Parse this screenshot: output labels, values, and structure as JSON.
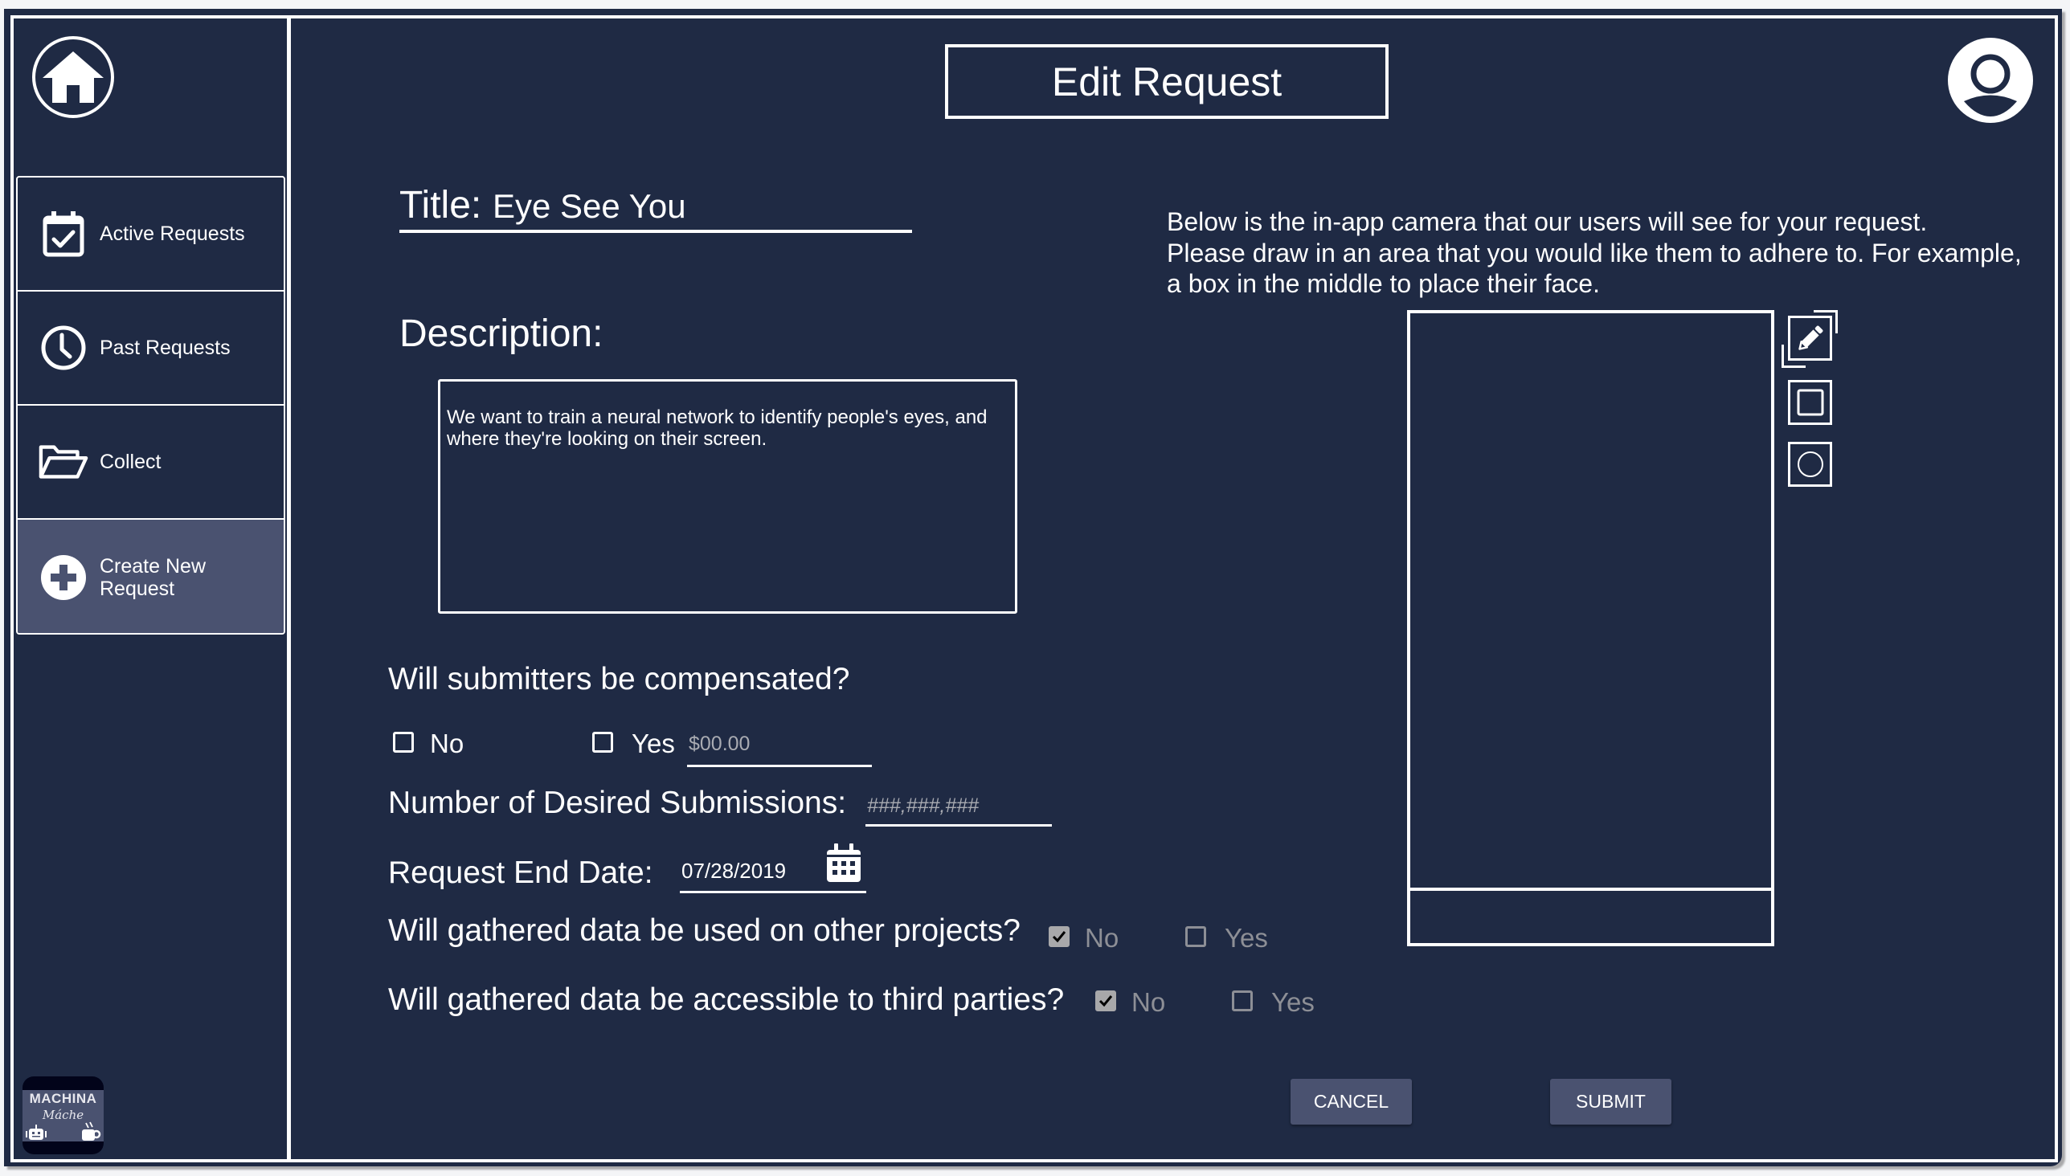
{
  "header": {
    "title": "Edit Request"
  },
  "sidebar": {
    "home_icon": "home-icon",
    "items": [
      {
        "label": "Active Requests",
        "icon": "calendar-check-icon",
        "active": false
      },
      {
        "label": "Past Requests",
        "icon": "clock-icon",
        "active": false
      },
      {
        "label": "Collect",
        "icon": "folder-open-icon",
        "active": false
      },
      {
        "label": "Create New Request",
        "icon": "plus-circle-icon",
        "active": true
      }
    ],
    "logo": {
      "line1": "MACHINA",
      "line2": "Máche"
    }
  },
  "user": {
    "avatar_icon": "user-circle-icon"
  },
  "form": {
    "title_label": "Title:",
    "title_value": "Eye See You",
    "description_label": "Description:",
    "description_value": "We want to train a neural network to identify people's eyes, and where they're looking on their screen.",
    "compensation": {
      "question": "Will submitters be compensated?",
      "no_label": "No",
      "no_checked": false,
      "yes_label": "Yes",
      "yes_checked": false,
      "amount_placeholder": "$00.00",
      "amount_value": ""
    },
    "submissions": {
      "label": "Number of Desired Submissions:",
      "placeholder": "###,###,###",
      "value": ""
    },
    "end_date": {
      "label": "Request End Date:",
      "value": "07/28/2019",
      "calendar_icon": "calendar-icon"
    },
    "other_projects": {
      "question": "Will gathered data be used on other projects?",
      "no_label": "No",
      "no_checked": true,
      "yes_label": "Yes",
      "yes_checked": false
    },
    "third_parties": {
      "question": "Will gathered data be accessible to third parties?",
      "no_label": "No",
      "no_checked": true,
      "yes_label": "Yes",
      "yes_checked": false
    }
  },
  "camera": {
    "instructions": "Below is the in-app camera that our users will see for your request. Please draw in an area that you would like them to adhere to. For example, a box in the middle to place their face.",
    "instruction_lines": [
      "Below is the in-app camera that our users will see for your request.",
      "Please draw in an area that you would like them to adhere to. For example,",
      "a box in the middle to place their face."
    ],
    "tools": [
      {
        "name": "pencil",
        "icon": "pencil-icon",
        "selected": true
      },
      {
        "name": "rectangle",
        "icon": "square-icon",
        "selected": false
      },
      {
        "name": "circle",
        "icon": "circle-icon",
        "selected": false
      }
    ]
  },
  "actions": {
    "cancel_label": "CANCEL",
    "submit_label": "SUBMIT"
  },
  "colors": {
    "background": "#1f2a44",
    "accent": "#4a5270",
    "text": "#ffffff",
    "muted_text": "#8d8f96",
    "page_background": "#f4f5f7"
  }
}
